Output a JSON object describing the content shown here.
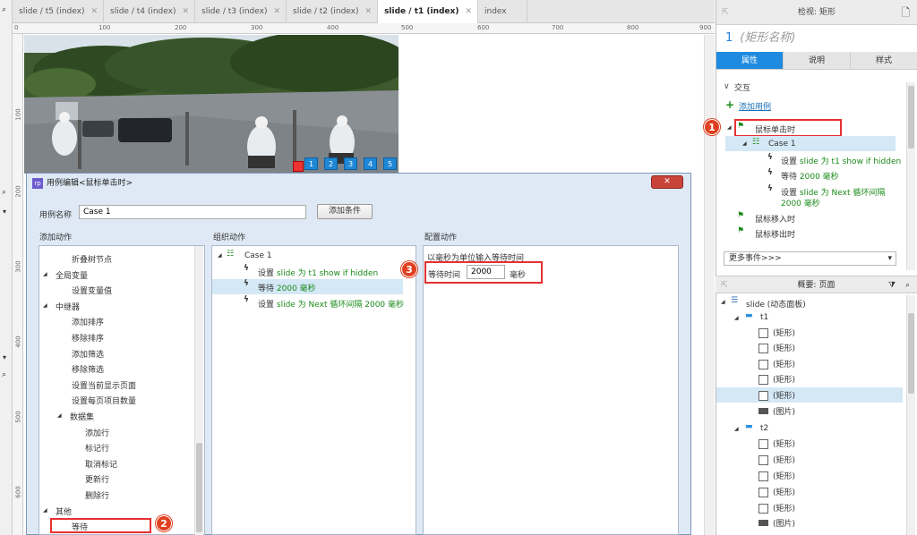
{
  "tabs": [
    {
      "label": "slide / t5 (index)",
      "active": false
    },
    {
      "label": "slide / t4 (index)",
      "active": false
    },
    {
      "label": "slide / t3 (index)",
      "active": false
    },
    {
      "label": "slide / t2 (index)",
      "active": false
    },
    {
      "label": "slide / t1 (index)",
      "active": true
    },
    {
      "label": "index",
      "active": false
    }
  ],
  "ruler_h": [
    "0",
    "100",
    "200",
    "300",
    "400",
    "500",
    "600",
    "700",
    "800",
    "900"
  ],
  "ruler_v": [
    "100",
    "200",
    "300",
    "400",
    "500",
    "600"
  ],
  "pager": [
    "1",
    "2",
    "3",
    "4",
    "5"
  ],
  "inspector": {
    "header": "检视: 矩形",
    "title_num": "1",
    "title_name": "(矩形名称)",
    "tabs": [
      "属性",
      "说明",
      "样式"
    ],
    "section": "交互",
    "add_case": "添加用例",
    "events": {
      "click": "鼠标单击时",
      "case": "Case 1",
      "actions": [
        {
          "verb": "设置",
          "text": "slide 为 t1 show if hidden"
        },
        {
          "verb": "等待",
          "text": "2000 毫秒"
        },
        {
          "verb": "设置",
          "text": "slide 为 Next 循环间隔"
        },
        {
          "verb": "",
          "text": "2000 毫秒"
        }
      ],
      "enter": "鼠标移入时",
      "leave": "鼠标移出时"
    },
    "more_events": "更多事件>>>"
  },
  "overview": {
    "header": "概要: 页面",
    "root": "slide (动态面板)",
    "t1": "t1",
    "t1_items": [
      "(矩形)",
      "(矩形)",
      "(矩形)",
      "(矩形)",
      "(矩形)",
      "(图片)"
    ],
    "t2": "t2",
    "t2_items": [
      "(矩形)",
      "(矩形)",
      "(矩形)",
      "(矩形)",
      "(矩形)",
      "(图片)"
    ]
  },
  "dialog": {
    "title": "用例编辑<鼠标单击时>",
    "name_label": "用例名称",
    "name_value": "Case 1",
    "add_condition": "添加条件",
    "col_add": "添加动作",
    "col_org": "组织动作",
    "col_cfg": "配置动作",
    "add_list": [
      {
        "text": "折叠树节点",
        "indent": 2,
        "arrow": ""
      },
      {
        "text": "全局变量",
        "indent": 1,
        "arrow": "◢"
      },
      {
        "text": "设置变量值",
        "indent": 2,
        "arrow": ""
      },
      {
        "text": "中继器",
        "indent": 1,
        "arrow": "◢"
      },
      {
        "text": "添加排序",
        "indent": 2,
        "arrow": ""
      },
      {
        "text": "移除排序",
        "indent": 2,
        "arrow": ""
      },
      {
        "text": "添加筛选",
        "indent": 2,
        "arrow": ""
      },
      {
        "text": "移除筛选",
        "indent": 2,
        "arrow": ""
      },
      {
        "text": "设置当前显示页面",
        "indent": 2,
        "arrow": ""
      },
      {
        "text": "设置每页项目数量",
        "indent": 2,
        "arrow": ""
      },
      {
        "text": "数据集",
        "indent": 2,
        "arrow": "◢"
      },
      {
        "text": "添加行",
        "indent": 3,
        "arrow": ""
      },
      {
        "text": "标记行",
        "indent": 3,
        "arrow": ""
      },
      {
        "text": "取消标记",
        "indent": 3,
        "arrow": ""
      },
      {
        "text": "更新行",
        "indent": 3,
        "arrow": ""
      },
      {
        "text": "删除行",
        "indent": 3,
        "arrow": ""
      },
      {
        "text": "其他",
        "indent": 1,
        "arrow": "◢"
      },
      {
        "text": "等待",
        "indent": 2,
        "arrow": ""
      }
    ],
    "org": {
      "case": "Case 1",
      "actions": [
        {
          "verb": "设置",
          "text": "slide 为 t1 show if hidden"
        },
        {
          "verb": "等待",
          "text": "2000 毫秒"
        },
        {
          "verb": "设置",
          "text": "slide 为 Next 循环间隔 2000 毫秒"
        }
      ]
    },
    "cfg": {
      "hint": "以毫秒为单位输入等待时间",
      "wait_label": "等待时间",
      "wait_value": "2000",
      "unit": "毫秒"
    }
  },
  "markers": [
    "1",
    "2",
    "3"
  ]
}
